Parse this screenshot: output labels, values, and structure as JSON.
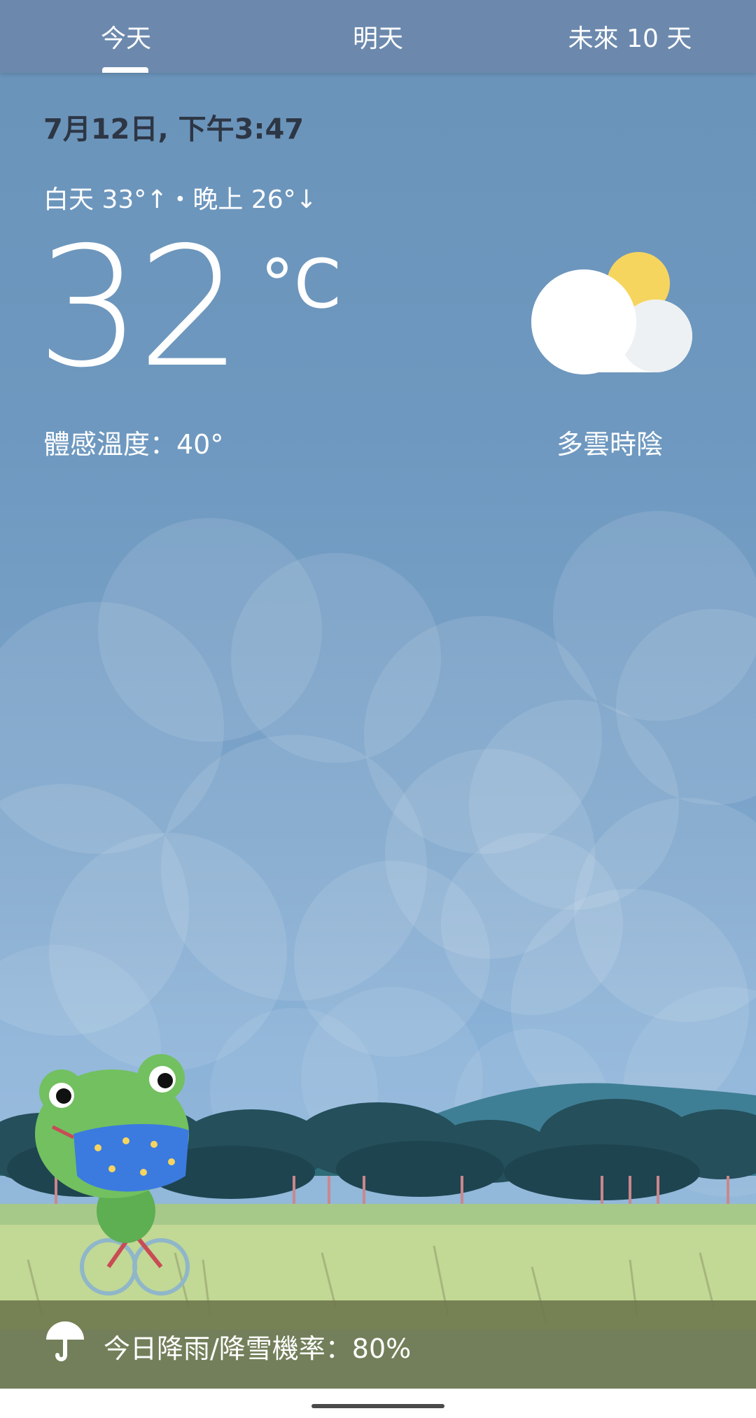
{
  "tabs": [
    {
      "label": "今天",
      "selected": true
    },
    {
      "label": "明天",
      "selected": false
    },
    {
      "label": "未來 10 天",
      "selected": false
    }
  ],
  "weather": {
    "datetime": "7月12日, 下午3:47",
    "high_low": "白天 33°↑・晚上 26°↓",
    "temperature": "32",
    "unit": "°C",
    "feels_like": "體感溫度：40°",
    "condition": "多雲時陰",
    "condition_icon": "partly-cloudy-icon"
  },
  "rain": {
    "icon": "umbrella-icon",
    "text": "今日降雨/降雪機率：80%"
  },
  "colors": {
    "tab_bar": "#6c89ad",
    "sky_top": "#6a93b9",
    "rain_bar": "#707a4e",
    "sun": "#f6d55f"
  }
}
